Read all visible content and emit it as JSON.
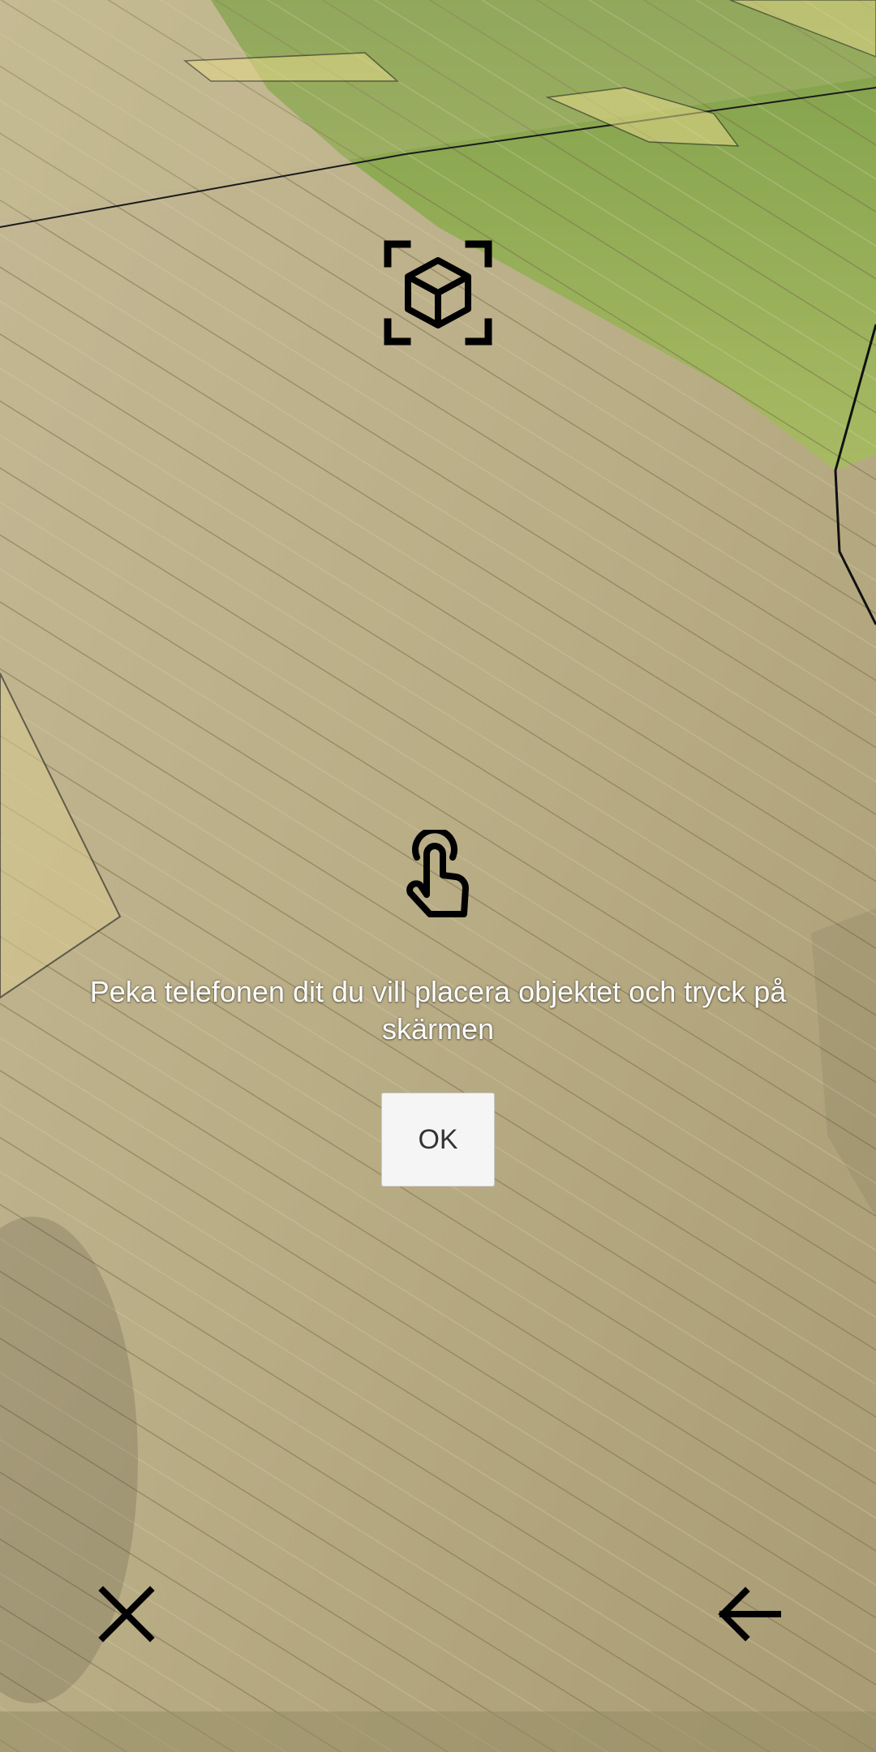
{
  "ar_view": {
    "scene": "ar-camera-feed",
    "instruction_text": "Peka telefonen dit du vill placera objektet och tryck på skärmen",
    "ok_label": "OK",
    "icons": {
      "top": "ar-object-scan-icon",
      "middle": "tap-gesture-icon",
      "close": "close-icon",
      "back": "arrow-left-icon"
    }
  },
  "colors": {
    "deck": "#b8ab84",
    "grass": "#9fb35a",
    "plane_overlay": "#e6d98a",
    "icon": "#000000",
    "text": "#ffffff"
  }
}
